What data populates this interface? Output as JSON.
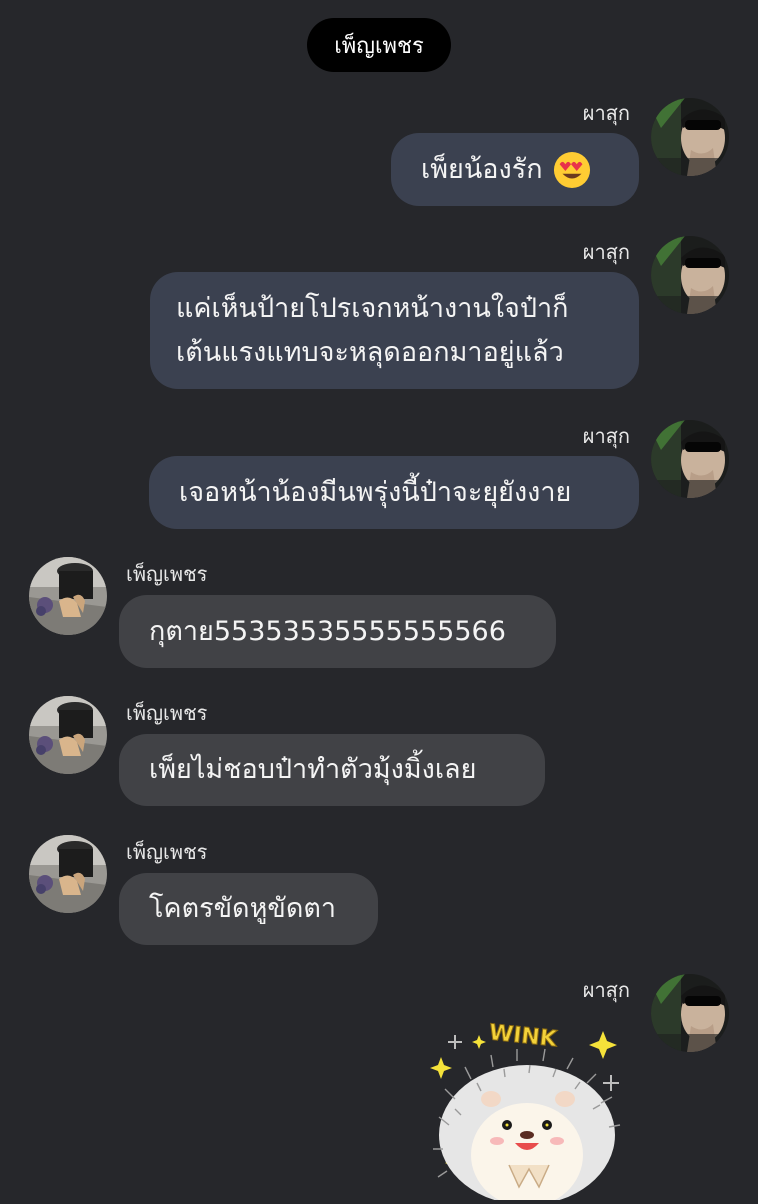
{
  "header": {
    "chat_title": "เพ็ญเพชร"
  },
  "participants": {
    "self_name": "ผาสุก",
    "other_name": "เพ็ญเพชร"
  },
  "messages": [
    {
      "sender": "ผาสุก",
      "text": "เพ็ยน้องรัก",
      "emoji": "heart-eyes-emoji"
    },
    {
      "sender": "ผาสุก",
      "lines": [
        "แค่เห็นป้ายโปรเจกหน้างานใจป๋าก็",
        "เต้นแรงแทบจะหลุดออกมาอยู่แล้ว"
      ]
    },
    {
      "sender": "ผาสุก",
      "text": "เจอหน้าน้องมีนพรุ่งนี้ป๋าจะยุยังงาย"
    },
    {
      "sender": "เพ็ญเพชร",
      "text": "กุตาย55353535555555566"
    },
    {
      "sender": "เพ็ญเพชร",
      "text": "เพ็ยไม่ชอบป๋าทำตัวมุ้งมิ้งเลย"
    },
    {
      "sender": "เพ็ญเพชร",
      "text": "โคตรขัดหูขัดตา"
    },
    {
      "sender": "ผาสุก",
      "sticker": "hedgehog-wink-sticker",
      "sticker_text": "WINK"
    }
  ],
  "colors": {
    "background": "#26272b",
    "outgoing_bubble": "#3b4150",
    "incoming_bubble": "#414246",
    "title_pill": "#000000"
  }
}
